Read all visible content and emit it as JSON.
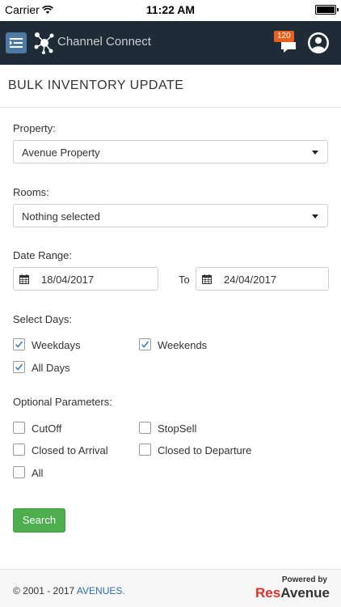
{
  "status_bar": {
    "carrier": "Carrier",
    "time": "11:22 AM"
  },
  "header": {
    "brand_part1": "Channel ",
    "brand_part2": "Connect",
    "notification_count": "120",
    "colors": {
      "bar": "#1f2b36",
      "accent": "#f36f21",
      "badge": "#e8601c"
    }
  },
  "page": {
    "title": "BULK INVENTORY UPDATE"
  },
  "form": {
    "property_label": "Property:",
    "property_value": "Avenue Property",
    "rooms_label": "Rooms:",
    "rooms_value": "Nothing selected",
    "date_range_label": "Date Range:",
    "date_from": "18/04/2017",
    "to_label": "To",
    "date_to": "24/04/2017",
    "select_days_label": "Select Days:",
    "days": [
      {
        "label": "Weekdays",
        "checked": true
      },
      {
        "label": "Weekends",
        "checked": true
      },
      {
        "label": "All Days",
        "checked": true
      }
    ],
    "optional_label": "Optional Parameters:",
    "optional": [
      {
        "label": "CutOff",
        "checked": false
      },
      {
        "label": "StopSell",
        "checked": false
      },
      {
        "label": "Closed to Arrival",
        "checked": false
      },
      {
        "label": "Closed to Departure",
        "checked": false
      },
      {
        "label": "All",
        "checked": false
      }
    ],
    "search_label": "Search"
  },
  "footer": {
    "copyright": "© 2001 - 2017 ",
    "company": "AVENUES.",
    "powered_by": "Powered by",
    "logo_res": "Res",
    "logo_avenue": "Avenue"
  }
}
